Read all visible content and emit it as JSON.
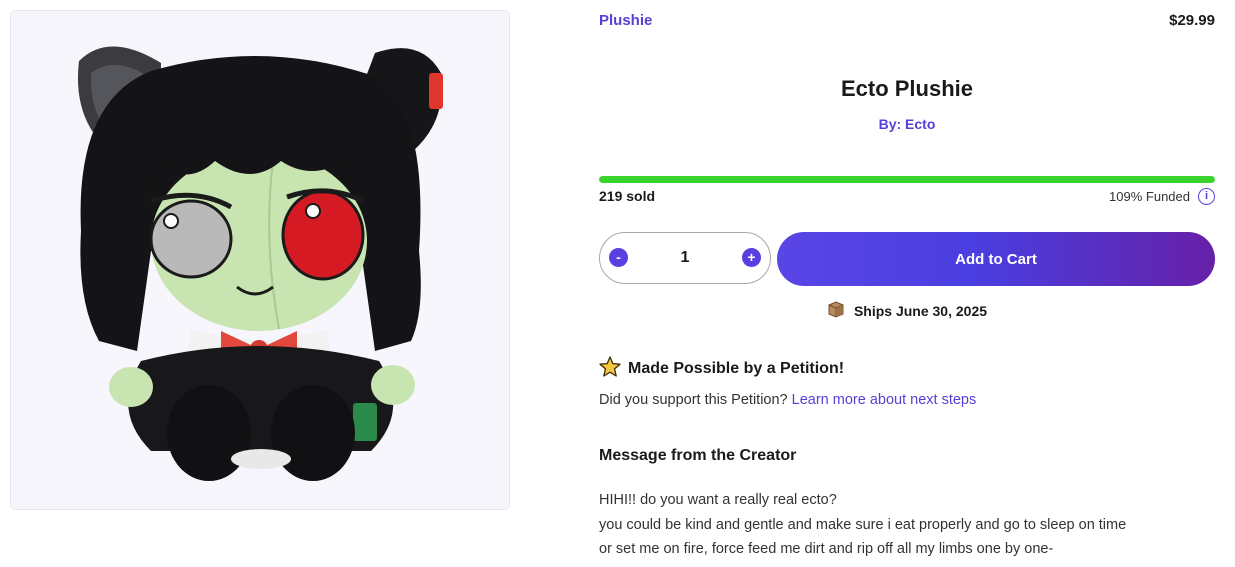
{
  "product": {
    "category": "Plushie",
    "price": "$29.99",
    "title": "Ecto Plushie",
    "creator": "By: Ecto"
  },
  "funding": {
    "sold": "219 sold",
    "funded": "109% Funded",
    "info_icon": "info-icon",
    "progress_fraction": 1.0,
    "progress_color": "#3bd42c"
  },
  "cart": {
    "minus_label": "-",
    "plus_label": "+",
    "quantity": "1",
    "add_label": "Add to Cart",
    "accent": "#5a3fe0"
  },
  "shipping": {
    "icon": "package-box-icon",
    "text": "Ships June 30, 2025"
  },
  "petition": {
    "icon": "star-icon",
    "heading": "Made Possible by a Petition!",
    "question": "Did you support this Petition?",
    "link": "Learn more about next steps"
  },
  "message": {
    "heading": "Message from the Creator",
    "lines": [
      "HIHI!! do you want a really real ecto?",
      "you could be kind and gentle and make sure i eat properly and go to sleep on time",
      "or set me on fire, force feed me dirt and rip off all my limbs one by one-"
    ]
  }
}
